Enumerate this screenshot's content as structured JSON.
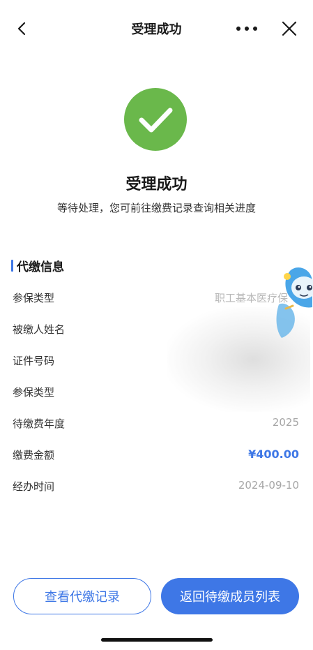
{
  "nav": {
    "title": "受理成功",
    "back_icon": "chevron-left-icon",
    "more_icon": "more-dots-icon",
    "close_icon": "close-icon"
  },
  "result": {
    "icon": "check-circle-icon",
    "icon_color": "#6ab84b",
    "title": "受理成功",
    "subtitle": "等待处理，您可前往缴费记录查询相关进度"
  },
  "section": {
    "title": "代缴信息",
    "accent_color": "#3e77e6"
  },
  "rows": [
    {
      "label": "参保类型",
      "value": "职工基本医疗保"
    },
    {
      "label": "被缴人姓名",
      "value": ""
    },
    {
      "label": "证件号码",
      "value": ""
    },
    {
      "label": "参保类型",
      "value": ""
    },
    {
      "label": "待缴费年度",
      "value": "2025"
    },
    {
      "label": "缴费金额",
      "value": "¥400.00"
    },
    {
      "label": "经办时间",
      "value": "2024-09-10"
    }
  ],
  "buttons": {
    "view_records": "查看代缴记录",
    "back_to_list": "返回待缴成员列表"
  }
}
